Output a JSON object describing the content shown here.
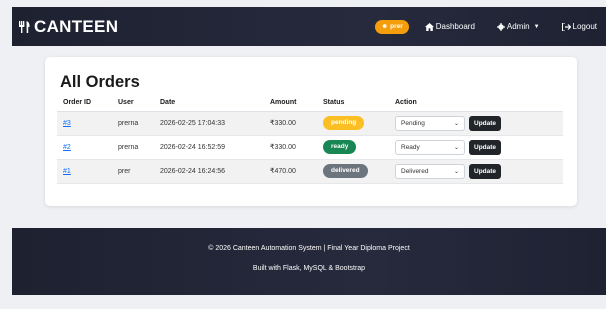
{
  "navbar": {
    "brand": "CANTEEN",
    "user_pill": "prer",
    "links": {
      "dashboard": "Dashboard",
      "admin": "Admin",
      "logout": "Logout"
    }
  },
  "page": {
    "title": "All Orders",
    "columns": [
      "Order ID",
      "User",
      "Date",
      "Amount",
      "Status",
      "Action"
    ],
    "orders": [
      {
        "id": "#3",
        "user": "prerna",
        "date": "2026-02-25 17:04:33",
        "amount": "₹330.00",
        "status": "pending",
        "select": "Pending",
        "action": "Update"
      },
      {
        "id": "#2",
        "user": "prerna",
        "date": "2026-02-24 16:52:59",
        "amount": "₹330.00",
        "status": "ready",
        "select": "Ready",
        "action": "Update"
      },
      {
        "id": "#1",
        "user": "prer",
        "date": "2026-02-24 16:24:56",
        "amount": "₹470.00",
        "status": "delivered",
        "select": "Delivered",
        "action": "Update"
      }
    ]
  },
  "footer": {
    "line1": "© 2026 Canteen Automation System | Final Year Diploma Project",
    "line2": "Built with Flask, MySQL & Bootstrap"
  },
  "colors": {
    "pending": "#fbbf24",
    "ready": "#198754",
    "delivered": "#6c757d",
    "user_pill": "#f59e0b",
    "link": "#0d6efd"
  }
}
